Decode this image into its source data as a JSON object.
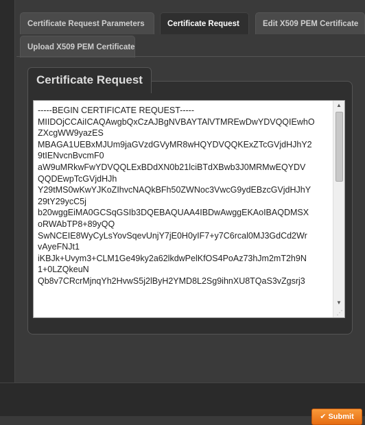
{
  "tabs": [
    {
      "label": "Certificate Request Parameters",
      "active": false
    },
    {
      "label": "Certificate Request",
      "active": true
    },
    {
      "label": "Edit X509 PEM Certificate",
      "active": false
    },
    {
      "label": "Upload X509 PEM Certificate",
      "active": false
    }
  ],
  "section": {
    "title": "Certificate Request"
  },
  "certificate": {
    "text": "-----BEGIN CERTIFICATE REQUEST-----\nMIIDOjCCAiICAQAwgbQxCzAJBgNVBAYTAlVTMREwDwYDVQQIEwhO\nZXcgWW9yazES\nMBAGA1UEBxMJUm9jaGVzdGVyMR8wHQYDVQQKExZTcGVjdHJhY2\n9tIENvcnBvcmF0\naW9uMRkwFwYDVQQLExBDdXN0b21lciBTdXBwb3J0MRMwEQYDV\nQQDEwpTcGVjdHJh\nY29tMS0wKwYJKoZIhvcNAQkBFh50ZWNoc3VwcG9ydEBzcGVjdHJhY\n29tY29ycC5j\nb20wggEiMA0GCSqGSIb3DQEBAQUAA4IBDwAwggEKAoIBAQDMSX\noRWAbTP8+89yQQ\nSwNCEIE8WyCyLsYovSqevUnjY7jE0H0yIF7+y7C6rcal0MJ3GdCd2Wr\nvAyeFNJt1\niKBJk+Uvym3+CLM1Ge49ky2a62lkdwPelKfOS4PoAz73hJm2mT2h9N\n1+0LZQkeuN\nQb8v7CRcrMjnqYh2HvwS5j2lByH2YMD8L2Sg9ihnXU8TQaS3vZgsrj3"
  },
  "actions": {
    "submit_label": "Submit"
  },
  "colors": {
    "accent": "#f0851f",
    "background": "#3a3a3a"
  }
}
